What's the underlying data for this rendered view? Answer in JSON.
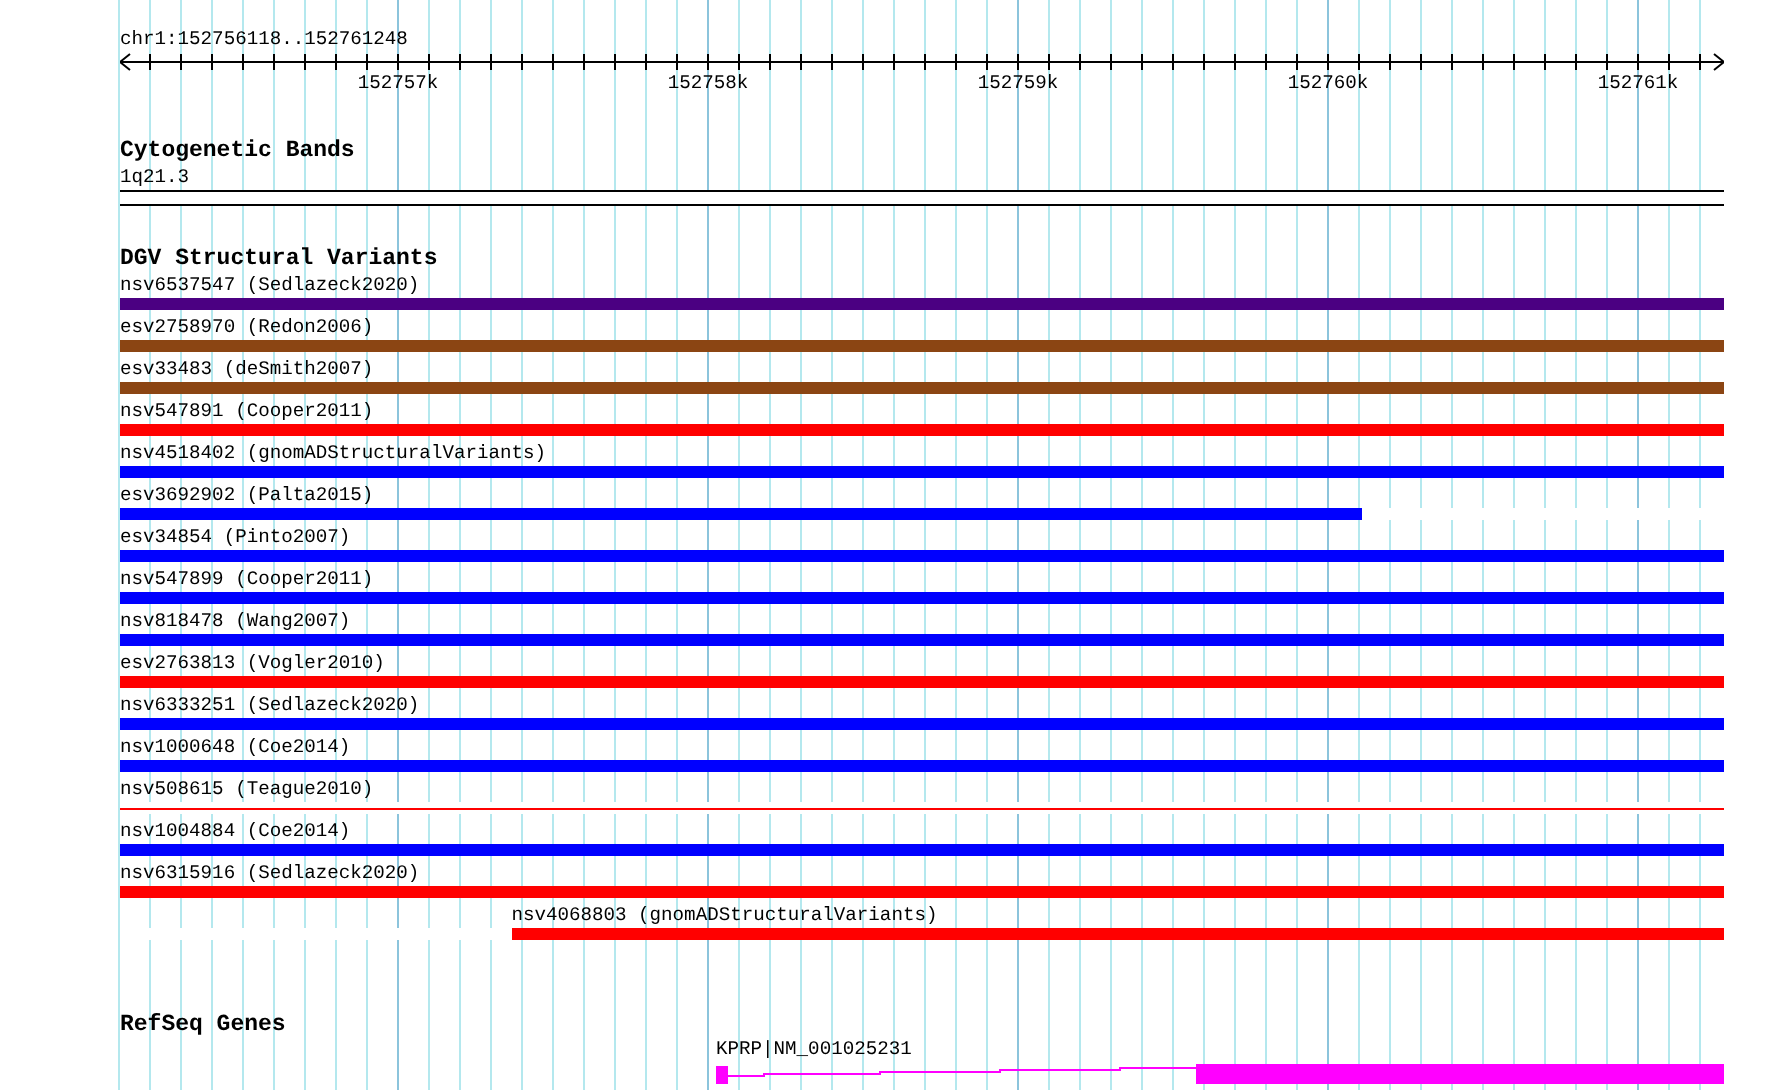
{
  "location": "chr1:152756118..152761248",
  "ruler": {
    "ticks": [
      "152757k",
      "152758k",
      "152759k",
      "152760k",
      "152761k"
    ]
  },
  "cytobands": {
    "title": "Cytogenetic Bands",
    "band": "1q21.3"
  },
  "dgv": {
    "title": "DGV Structural Variants",
    "features": [
      {
        "label": "nsv6537547 (Sedlazeck2020)",
        "color": "#4b0082",
        "kind": "bar",
        "level": 1
      },
      {
        "label": "esv2758970 (Redon2006)",
        "color": "#8b4513",
        "kind": "bar",
        "level": 1
      },
      {
        "label": "esv33483 (deSmith2007)",
        "color": "#8b4513",
        "kind": "bar",
        "level": 1
      },
      {
        "label": "nsv547891 (Cooper2011)",
        "color": "#ff0000",
        "kind": "bar",
        "level": 1
      },
      {
        "label": "nsv4518402 (gnomADStructuralVariants)",
        "color": "#0000ff",
        "kind": "bar",
        "level": 1
      },
      {
        "label": "esv3692902 (Palta2015)",
        "color": "#0000ff",
        "kind": "bar",
        "level": 0.774
      },
      {
        "label": "esv34854 (Pinto2007)",
        "color": "#0000ff",
        "kind": "bar",
        "level": 1
      },
      {
        "label": "nsv547899 (Cooper2011)",
        "color": "#0000ff",
        "kind": "bar",
        "level": 1
      },
      {
        "label": "nsv818478 (Wang2007)",
        "color": "#0000ff",
        "kind": "bar",
        "level": 1
      },
      {
        "label": "esv2763813 (Vogler2010)",
        "color": "#ff0000",
        "kind": "bar",
        "level": 1
      },
      {
        "label": "nsv6333251 (Sedlazeck2020)",
        "color": "#0000ff",
        "kind": "bar",
        "level": 1
      },
      {
        "label": "nsv1000648 (Coe2014)",
        "color": "#0000ff",
        "kind": "bar",
        "level": 1
      },
      {
        "label": "nsv508615 (Teague2010)",
        "color": "#ff0000",
        "kind": "line",
        "level": 1
      },
      {
        "label": "nsv1004884 (Coe2014)",
        "color": "#0000ff",
        "kind": "bar",
        "level": 1
      },
      {
        "label": "nsv6315916 (Sedlazeck2020)",
        "color": "#ff0000",
        "kind": "bar",
        "level": 1
      },
      {
        "label": "nsv4068803 (gnomADStructuralVariants)",
        "color": "#ff0000",
        "kind": "end-bar",
        "level": 0.756
      }
    ]
  },
  "refseq": {
    "title": "RefSeq Genes",
    "genes": [
      {
        "label": "KPRP|NM_001025231"
      }
    ]
  }
}
